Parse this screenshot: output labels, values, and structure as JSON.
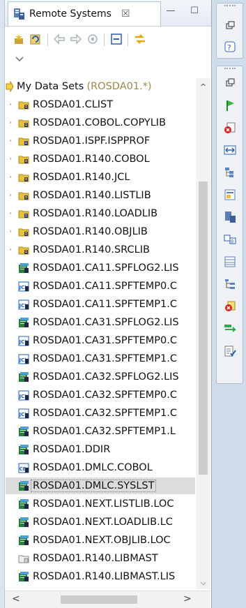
{
  "tab": {
    "title": "Remote Systems",
    "close": "☒",
    "minimize": "—",
    "maximize": "☐"
  },
  "tree": {
    "root": {
      "label": "My Data Sets",
      "filter": "(ROSDA01.*)"
    },
    "items": [
      {
        "label": "ROSDA01.CLIST",
        "type": "folder",
        "expand": "›"
      },
      {
        "label": "ROSDA01.COBOL.COPYLIB",
        "type": "folder",
        "expand": "›"
      },
      {
        "label": "ROSDA01.ISPF.ISPPROF",
        "type": "folder",
        "expand": "›"
      },
      {
        "label": "ROSDA01.R140.COBOL",
        "type": "folder",
        "expand": "›"
      },
      {
        "label": "ROSDA01.R140.JCL",
        "type": "folder",
        "expand": "›"
      },
      {
        "label": "ROSDA01.R140.LISTLIB",
        "type": "folder",
        "expand": "›"
      },
      {
        "label": "ROSDA01.R140.LOADLIB",
        "type": "folder",
        "expand": "›"
      },
      {
        "label": "ROSDA01.R140.OBJLIB",
        "type": "folder",
        "expand": "›"
      },
      {
        "label": "ROSDA01.R140.SRCLIB",
        "type": "folder",
        "expand": "›"
      },
      {
        "label": "ROSDA01.CA11.SPFLOG2.LIS",
        "type": "list",
        "expand": ""
      },
      {
        "label": "ROSDA01.CA11.SPFTEMP0.C",
        "type": "jcl",
        "expand": ""
      },
      {
        "label": "ROSDA01.CA11.SPFTEMP1.C",
        "type": "jcl",
        "expand": ""
      },
      {
        "label": "ROSDA01.CA31.SPFLOG2.LIS",
        "type": "list",
        "expand": ""
      },
      {
        "label": "ROSDA01.CA31.SPFTEMP0.C",
        "type": "jcl",
        "expand": ""
      },
      {
        "label": "ROSDA01.CA31.SPFTEMP1.C",
        "type": "jcl",
        "expand": ""
      },
      {
        "label": "ROSDA01.CA32.SPFLOG2.LIS",
        "type": "list",
        "expand": ""
      },
      {
        "label": "ROSDA01.CA32.SPFTEMP0.C",
        "type": "jcl",
        "expand": ""
      },
      {
        "label": "ROSDA01.CA32.SPFTEMP1.C",
        "type": "jcl",
        "expand": ""
      },
      {
        "label": "ROSDA01.CA32.SPFTEMP1.L",
        "type": "list",
        "expand": ""
      },
      {
        "label": "ROSDA01.DDIR",
        "type": "list",
        "expand": ""
      },
      {
        "label": "ROSDA01.DMLC.COBOL",
        "type": "cobol",
        "expand": ""
      },
      {
        "label": "ROSDA01.DMLC.SYSLST",
        "type": "list",
        "expand": "",
        "selected": true
      },
      {
        "label": "ROSDA01.NEXT.LISTLIB.LOC",
        "type": "list",
        "expand": ""
      },
      {
        "label": "ROSDA01.NEXT.LOADLIB.LC",
        "type": "list",
        "expand": ""
      },
      {
        "label": "ROSDA01.NEXT.OBJLIB.LOC",
        "type": "list",
        "expand": ""
      },
      {
        "label": "ROSDA01.R140.LIBMAST",
        "type": "plain",
        "expand": ""
      },
      {
        "label": "ROSDA01.R140.LIBMAST.LIS",
        "type": "list",
        "expand": ""
      }
    ]
  },
  "scroll": {
    "up": "^",
    "down": "⌵",
    "left": "<",
    "right": ">"
  },
  "colors": {
    "folder": "#e8c23c",
    "list": "#2a7d3a",
    "jcl": "#1f5fbf",
    "accent": "#cfdcea"
  }
}
